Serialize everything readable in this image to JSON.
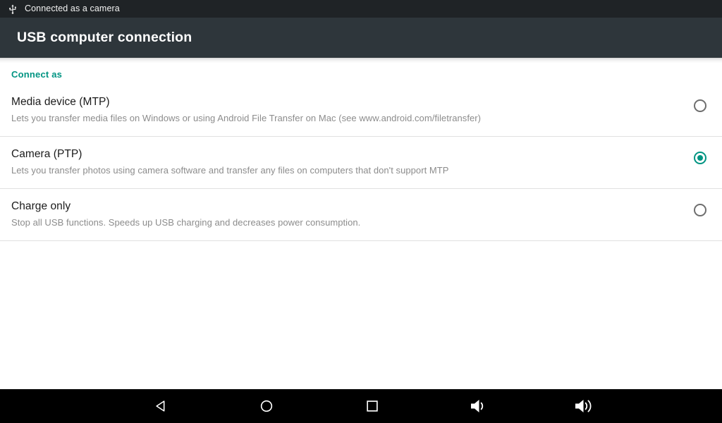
{
  "status_bar": {
    "icon": "usb-icon",
    "text": "Connected as a camera",
    "background": "#1f2326",
    "text_color": "#f2f2f2"
  },
  "action_bar": {
    "title": "USB computer connection",
    "background": "#2e363b",
    "title_color": "#ffffff"
  },
  "content": {
    "section_header": {
      "label": "Connect as",
      "color": "#009482"
    },
    "options": [
      {
        "title": "Media device (MTP)",
        "summary": "Lets you transfer media files on Windows or using Android File Transfer on Mac (see www.android.com/filetransfer)",
        "selected": false,
        "radio_name": "radio-media-device-mtp"
      },
      {
        "title": "Camera (PTP)",
        "summary": "Lets you transfer photos using camera software and transfer any files on computers that don't support MTP",
        "selected": true,
        "radio_name": "radio-camera-ptp"
      },
      {
        "title": "Charge only",
        "summary": "Stop all USB functions. Speeds up USB charging and decreases power consumption.",
        "selected": false,
        "radio_name": "radio-charge-only"
      }
    ],
    "selected_option": "Camera (PTP)",
    "accent_color": "#009482",
    "divider_color": "#e0e0e0",
    "title_color": "#1b1b1b",
    "summary_color": "#8c8c8c"
  },
  "nav_bar": {
    "background": "#000000",
    "icon_color": "#ffffff",
    "buttons": [
      {
        "name": "back-icon",
        "label": "Back"
      },
      {
        "name": "home-icon",
        "label": "Home"
      },
      {
        "name": "recents-icon",
        "label": "Recent apps"
      },
      {
        "name": "volume-down-icon",
        "label": "Volume down"
      },
      {
        "name": "volume-up-icon",
        "label": "Volume up"
      }
    ]
  }
}
